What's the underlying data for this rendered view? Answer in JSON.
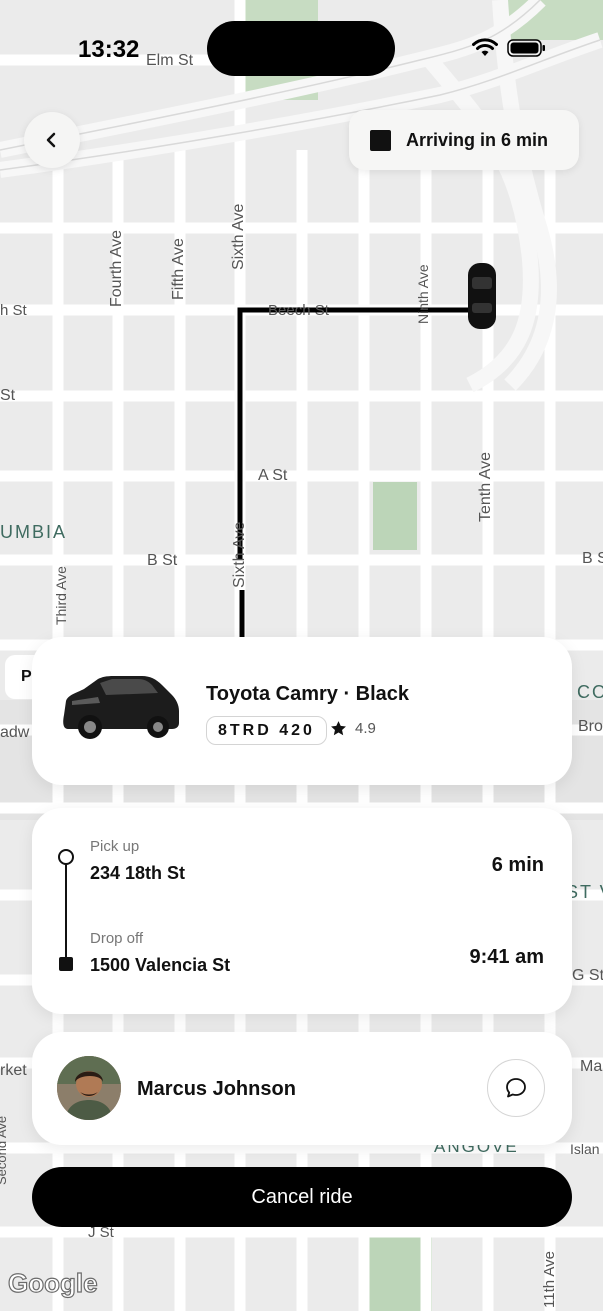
{
  "status_bar": {
    "time": "13:32"
  },
  "map": {
    "streets_vertical": [
      "Fourth Ave",
      "Fifth Ave",
      "Sixth Ave",
      "Ninth Ave",
      "Tenth Ave",
      "Sixth Ave",
      "Third Ave",
      "11th Ave",
      "Second Ave"
    ],
    "streets_horizontal": [
      "Elm St",
      "Beech St",
      "A St",
      "B St",
      "J St"
    ],
    "partial_labels": [
      "h St",
      "St",
      "B S",
      "Bro",
      "adw",
      "rket",
      "G St",
      "Ma",
      "Islan",
      "CO",
      "ST V",
      "Ninth Ave"
    ],
    "area_labels": [
      "UMBIA",
      "ANGOVE",
      "CONDOS"
    ],
    "google_logo": "Google",
    "p_marker": "P"
  },
  "header": {
    "eta": "Arriving in 6 min"
  },
  "vehicle": {
    "title": "Toyota Camry · Black",
    "plate": "8TRD 420",
    "rating": "4.9"
  },
  "route": {
    "pickup_caption": "Pick up",
    "pickup_address": "234 18th St",
    "pickup_time": "6 min",
    "dropoff_caption": "Drop off",
    "dropoff_address": "1500 Valencia St",
    "dropoff_time": "9:41 am"
  },
  "driver": {
    "name": "Marcus Johnson"
  },
  "actions": {
    "cancel_label": "Cancel ride"
  },
  "colors": {
    "accent": "#000000",
    "map_background": "#ebebeb",
    "road": "#ffffff",
    "park": "#b9d4b5",
    "card": "#ffffff"
  },
  "icons": [
    "back-chevron-icon",
    "wifi-icon",
    "battery-icon",
    "signal-icon",
    "car-icon",
    "star-icon",
    "chat-icon",
    "square-stop-icon"
  ]
}
